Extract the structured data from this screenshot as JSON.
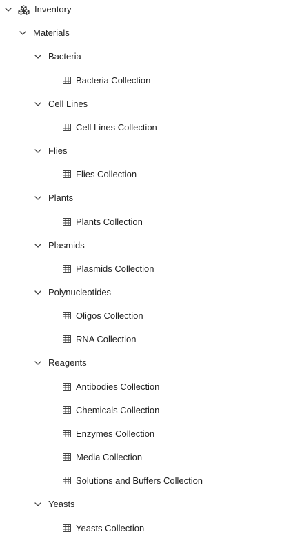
{
  "tree": {
    "root": {
      "label": "Inventory",
      "icon": "inventory-cubes-icon"
    },
    "materials": {
      "label": "Materials"
    },
    "groups": [
      {
        "label": "Bacteria",
        "children": [
          "Bacteria Collection"
        ]
      },
      {
        "label": "Cell Lines",
        "children": [
          "Cell Lines Collection"
        ]
      },
      {
        "label": "Flies",
        "children": [
          "Flies Collection"
        ]
      },
      {
        "label": "Plants",
        "children": [
          "Plants Collection"
        ]
      },
      {
        "label": "Plasmids",
        "children": [
          "Plasmids Collection"
        ]
      },
      {
        "label": "Polynucleotides",
        "children": [
          "Oligos Collection",
          "RNA Collection"
        ]
      },
      {
        "label": "Reagents",
        "children": [
          "Antibodies Collection",
          "Chemicals Collection",
          "Enzymes Collection",
          "Media Collection",
          "Solutions and Buffers Collection"
        ]
      },
      {
        "label": "Yeasts",
        "children": [
          "Yeasts Collection"
        ]
      }
    ],
    "collection_icon": "table-icon",
    "expand_icon": "chevron-down-icon"
  },
  "colors": {
    "text": "#1f1f1f",
    "icon": "#444444",
    "background": "#ffffff"
  }
}
